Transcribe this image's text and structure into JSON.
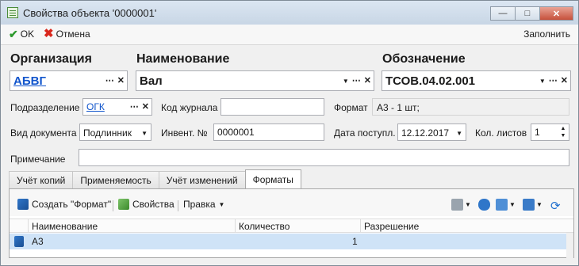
{
  "window": {
    "title": "Свойства объекта '0000001'",
    "controls": [
      "—",
      "□",
      "✕"
    ]
  },
  "toolbar": {
    "ok_label": "OK",
    "cancel_label": "Отмена",
    "fill_label": "Заполнить"
  },
  "header": {
    "organization_label": "Организация",
    "organization_value": "АБВГ",
    "name_label": "Наименование",
    "name_value": "Вал",
    "designation_label": "Обозначение",
    "designation_value": "ТСОВ.04.02.001"
  },
  "form": {
    "division_label": "Подразделение",
    "division_value": "ОГК",
    "journal_code_label": "Код журнала",
    "journal_code_value": "",
    "format_label": "Формат",
    "format_value": "А3 - 1 шт;",
    "doc_type_label": "Вид документа",
    "doc_type_value": "Подлинник",
    "inv_label": "Инвент. №",
    "inv_value": "0000001",
    "date_label": "Дата поступл.",
    "date_value": "12.12.2017",
    "sheets_label": "Кол. листов",
    "sheets_value": "1",
    "note_label": "Примечание",
    "note_value": ""
  },
  "tabs": [
    "Учёт копий",
    "Применяемость",
    "Учёт изменений",
    "Форматы"
  ],
  "active_tab": "Форматы",
  "panel_toolbar": {
    "create_label": "Создать \"Формат\"",
    "props_label": "Свойства",
    "edit_label": "Правка"
  },
  "table": {
    "columns": [
      "Наименование",
      "Количество",
      "Разрешение"
    ],
    "rows": [
      {
        "name": "А3",
        "qty": "1",
        "res": ""
      }
    ]
  },
  "icons": [
    "check-icon",
    "cancel-icon",
    "format-icon",
    "edit-icon",
    "print-icon",
    "user-icon",
    "settings-icon",
    "view-icon",
    "refresh-icon"
  ],
  "colors": {
    "link": "#1155cc",
    "selected_row": "#cfe3f7",
    "ok": "#2e9a2e",
    "cancel": "#d9261c"
  }
}
